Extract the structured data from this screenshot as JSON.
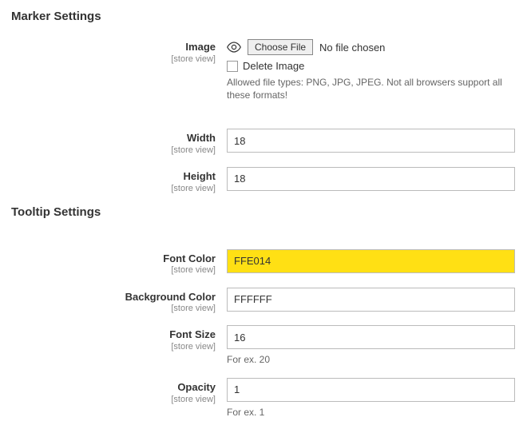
{
  "sections": {
    "marker": {
      "title": "Marker Settings"
    },
    "tooltip": {
      "title": "Tooltip Settings"
    }
  },
  "scope_label": "[store view]",
  "marker": {
    "image": {
      "label": "Image",
      "choose_button": "Choose File",
      "no_file": "No file chosen",
      "delete_label": "Delete Image",
      "allowed_note": "Allowed file types: PNG, JPG, JPEG. Not all browsers support all these formats!"
    },
    "width": {
      "label": "Width",
      "value": "18"
    },
    "height": {
      "label": "Height",
      "value": "18"
    }
  },
  "tooltip": {
    "font_color": {
      "label": "Font Color",
      "value": "FFE014",
      "highlight_color": "#ffe014"
    },
    "background_color": {
      "label": "Background Color",
      "value": "FFFFFF"
    },
    "font_size": {
      "label": "Font Size",
      "value": "16",
      "hint": "For ex. 20"
    },
    "opacity": {
      "label": "Opacity",
      "value": "1",
      "hint": "For ex. 1"
    }
  }
}
